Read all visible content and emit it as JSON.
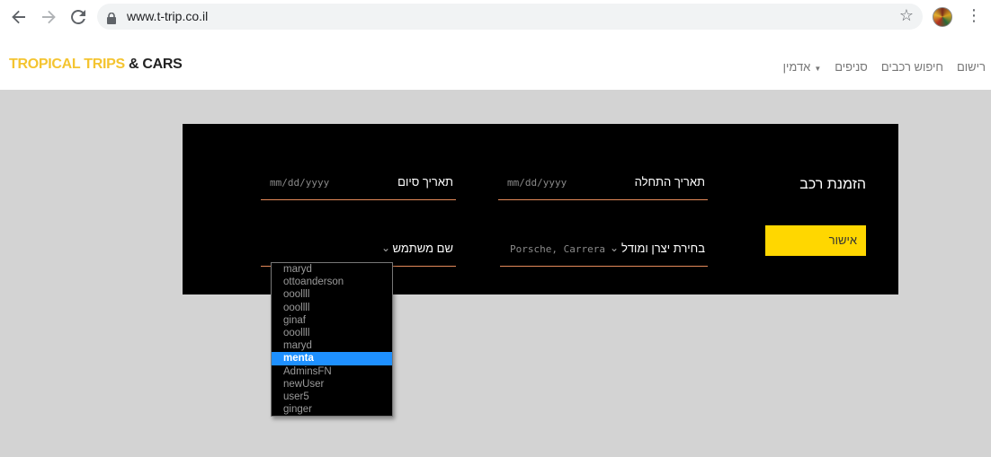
{
  "browser": {
    "url": "www.t-trip.co.il"
  },
  "logo": {
    "part1": "TROPICAL TRIPS",
    "part2": "& CARS"
  },
  "nav": {
    "items": [
      {
        "label": "רישום"
      },
      {
        "label": "חיפוש רכבים"
      },
      {
        "label": "סניפים"
      },
      {
        "label": "אדמין"
      }
    ]
  },
  "form": {
    "title": "הזמנת רכב",
    "start_date": {
      "label": "תאריך התחלה",
      "placeholder": "mm/dd/yyyy"
    },
    "end_date": {
      "label": "תאריך סיום",
      "placeholder": "mm/dd/yyyy"
    },
    "car_select": {
      "label": "בחירת יצרן ומודל",
      "value": "Porsche, Carrera"
    },
    "user_select": {
      "label": "שם משתמש"
    },
    "confirm_label": "אישור"
  },
  "user_dropdown": {
    "options": [
      "maryd",
      "ottoanderson",
      "ooollll",
      "ooollll",
      "ginaf",
      "ooollll",
      "maryd",
      "menta",
      "AdminsFN",
      "newUser",
      "user5",
      "ginger"
    ],
    "selected": "menta"
  }
}
